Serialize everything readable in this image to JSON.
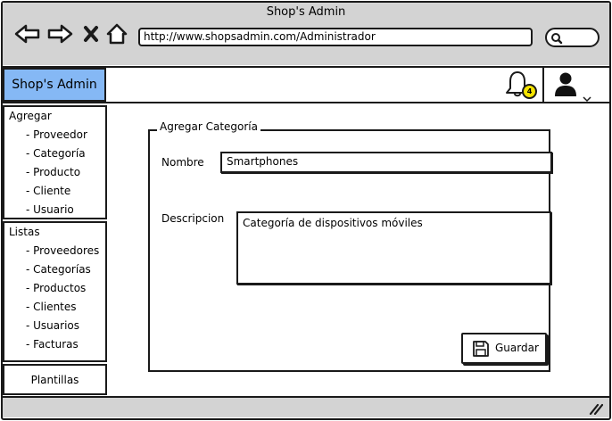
{
  "window": {
    "title": "Shop's Admin"
  },
  "browser": {
    "url": "http://www.shopsadmin.com/Administrador"
  },
  "header": {
    "brand": "Shop's Admin",
    "notification_count": "4"
  },
  "sidebar": {
    "agregar": {
      "heading": "Agregar",
      "items": [
        "- Proveedor",
        "- Categoría",
        "- Producto",
        "- Cliente",
        "- Usuario"
      ]
    },
    "listas": {
      "heading": "Listas",
      "items": [
        "- Proveedores",
        "- Categorías",
        "- Productos",
        "- Clientes",
        "- Usuarios",
        "- Facturas"
      ]
    },
    "plantillas": "Plantillas"
  },
  "form": {
    "legend": "Agregar Categoría",
    "nombre_label": "Nombre",
    "nombre_value": "Smartphones",
    "descripcion_label": "Descripcion",
    "descripcion_value": "Categoría de dispositivos móviles",
    "save_label": "Guardar"
  },
  "colors": {
    "brand_bg": "#85b8f5",
    "chrome": "#d3d3d3",
    "badge": "#f5e400"
  }
}
